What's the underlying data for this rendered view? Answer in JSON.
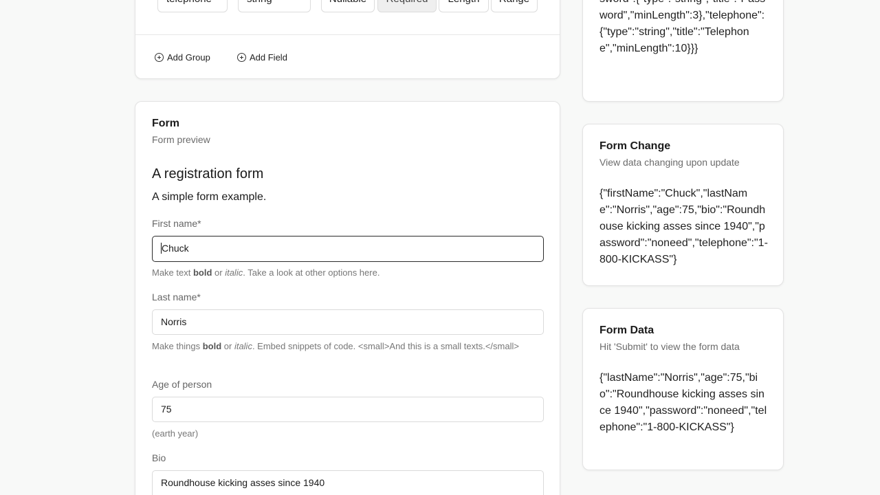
{
  "builder": {
    "field_name_value": "telephone",
    "field_type_value": "string",
    "toggles": {
      "nullable": "Nullable",
      "required": "Required",
      "length": "Length",
      "range": "Range"
    },
    "add_group_label": "Add Group",
    "add_field_label": "Add Field"
  },
  "form_card": {
    "title": "Form",
    "subtitle": "Form preview",
    "form_title": "A registration form",
    "form_description": "A simple form example.",
    "fields": {
      "first_name": {
        "label": "First name*",
        "value": "Chuck",
        "help_prefix": "Make text ",
        "help_bold": "bold",
        "help_or": " or ",
        "help_italic": "italic",
        "help_suffix": ". Take a look at other options here."
      },
      "last_name": {
        "label": "Last name*",
        "value": "Norris",
        "help_prefix": "Make things ",
        "help_bold": "bold",
        "help_or": " or ",
        "help_italic": "italic",
        "help_suffix": ". Embed snippets of code. <small>And this is a small texts.</small>"
      },
      "age": {
        "label": "Age of person",
        "value": "75",
        "help": "(earth year)"
      },
      "bio": {
        "label": "Bio",
        "value": "Roundhouse kicking asses since 1940"
      }
    }
  },
  "schema_card": {
    "json_tail": "sword\":{\"type\":\"string\",\"title\":\"Password\",\"minLength\":3},\"telephone\":{\"type\":\"string\",\"title\":\"Telephone\",\"minLength\":10}}}"
  },
  "change_card": {
    "title": "Form Change",
    "subtitle": "View data changing upon update",
    "json": "{\"firstName\":\"Chuck\",\"lastName\":\"Norris\",\"age\":75,\"bio\":\"Roundhouse kicking asses since 1940\",\"password\":\"noneed\",\"telephone\":\"1-800-KICKASS\"}"
  },
  "data_card": {
    "title": "Form Data",
    "subtitle": "Hit 'Submit' to view the form data",
    "json": "{\"lastName\":\"Norris\",\"age\":75,\"bio\":\"Roundhouse kicking asses since 1940\",\"password\":\"noneed\",\"telephone\":\"1-800-KICKASS\"}"
  },
  "icons": {
    "add_group": "plus-circle-icon",
    "add_field": "plus-circle-icon"
  }
}
